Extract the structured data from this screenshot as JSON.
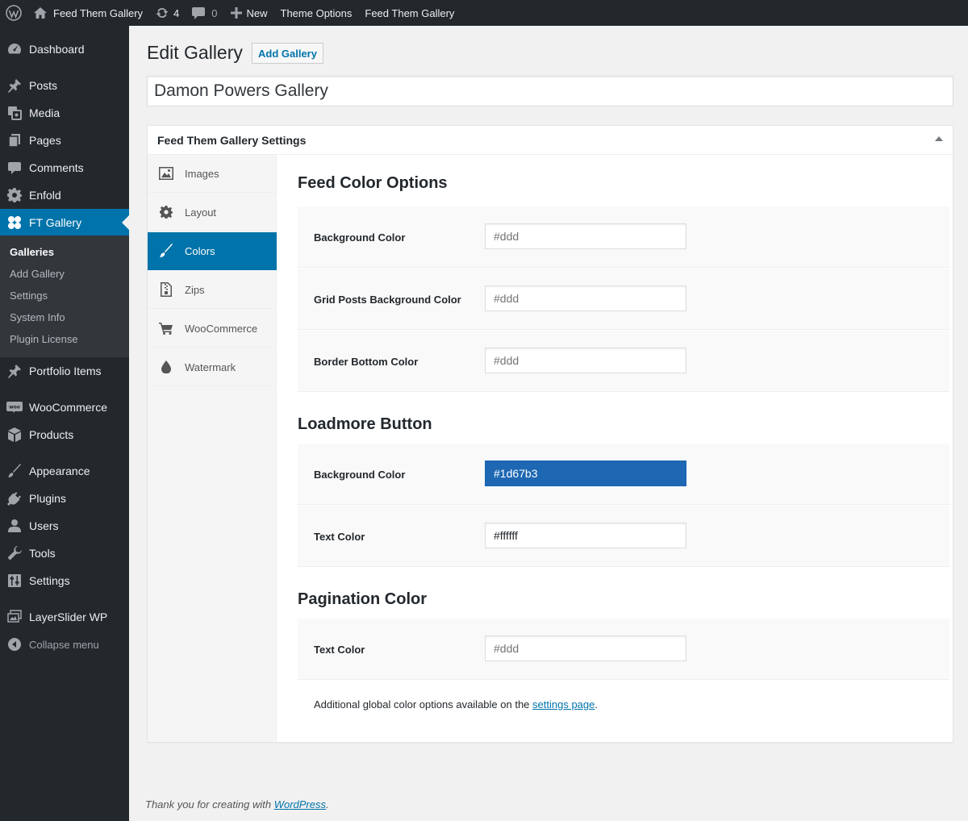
{
  "adminbar": {
    "site_name": "Feed Them Gallery",
    "updates_count": "4",
    "comments_count": "0",
    "new_label": "New",
    "theme_options_label": "Theme Options",
    "plugin_label": "Feed Them Gallery"
  },
  "sidebar": {
    "items": [
      {
        "label": "Dashboard",
        "icon": "dashboard-icon"
      },
      {
        "label": "Posts",
        "icon": "pin-icon"
      },
      {
        "label": "Media",
        "icon": "media-icon"
      },
      {
        "label": "Pages",
        "icon": "pages-icon"
      },
      {
        "label": "Comments",
        "icon": "comments-icon"
      },
      {
        "label": "Enfold",
        "icon": "gear-icon"
      },
      {
        "label": "FT Gallery",
        "icon": "gallery-icon"
      },
      {
        "label": "Portfolio Items",
        "icon": "pin-icon"
      },
      {
        "label": "WooCommerce",
        "icon": "woo-icon"
      },
      {
        "label": "Products",
        "icon": "box-icon"
      },
      {
        "label": "Appearance",
        "icon": "brush-icon"
      },
      {
        "label": "Plugins",
        "icon": "plug-icon"
      },
      {
        "label": "Users",
        "icon": "user-icon"
      },
      {
        "label": "Tools",
        "icon": "wrench-icon"
      },
      {
        "label": "Settings",
        "icon": "sliders-icon"
      },
      {
        "label": "LayerSlider WP",
        "icon": "layers-icon"
      }
    ],
    "collapse_label": "Collapse menu",
    "submenu": [
      "Galleries",
      "Add Gallery",
      "Settings",
      "System Info",
      "Plugin License"
    ]
  },
  "main": {
    "page_title": "Edit Gallery",
    "add_button": "Add Gallery",
    "gallery_title": "Damon Powers Gallery",
    "box_title": "Feed Them Gallery Settings",
    "tabs": [
      {
        "label": "Images",
        "icon": "image-icon"
      },
      {
        "label": "Layout",
        "icon": "gear-icon"
      },
      {
        "label": "Colors",
        "icon": "brush-icon"
      },
      {
        "label": "Zips",
        "icon": "zip-icon"
      },
      {
        "label": "WooCommerce",
        "icon": "cart-icon"
      },
      {
        "label": "Watermark",
        "icon": "drop-icon"
      }
    ],
    "sections": {
      "feed": {
        "title": "Feed Color Options",
        "rows": [
          {
            "label": "Background Color",
            "placeholder": "#ddd",
            "value": ""
          },
          {
            "label": "Grid Posts Background Color",
            "placeholder": "#ddd",
            "value": ""
          },
          {
            "label": "Border Bottom Color",
            "placeholder": "#ddd",
            "value": ""
          }
        ]
      },
      "loadmore": {
        "title": "Loadmore Button",
        "rows": [
          {
            "label": "Background Color",
            "placeholder": "",
            "value": "#1d67b3"
          },
          {
            "label": "Text Color",
            "placeholder": "",
            "value": "#ffffff"
          }
        ]
      },
      "pagination": {
        "title": "Pagination Color",
        "rows": [
          {
            "label": "Text Color",
            "placeholder": "#ddd",
            "value": ""
          }
        ]
      }
    },
    "footer_note_prefix": "Additional global color options available on the ",
    "footer_note_link": "settings page",
    "footer_note_suffix": "."
  },
  "footer": {
    "thanks_prefix": "Thank you for creating with ",
    "thanks_link": "WordPress",
    "thanks_suffix": "."
  },
  "colors": {
    "accent": "#0073aa",
    "admin_dark": "#23282d",
    "submenu_bg": "#32373c",
    "swatch": "#1d67b3"
  }
}
